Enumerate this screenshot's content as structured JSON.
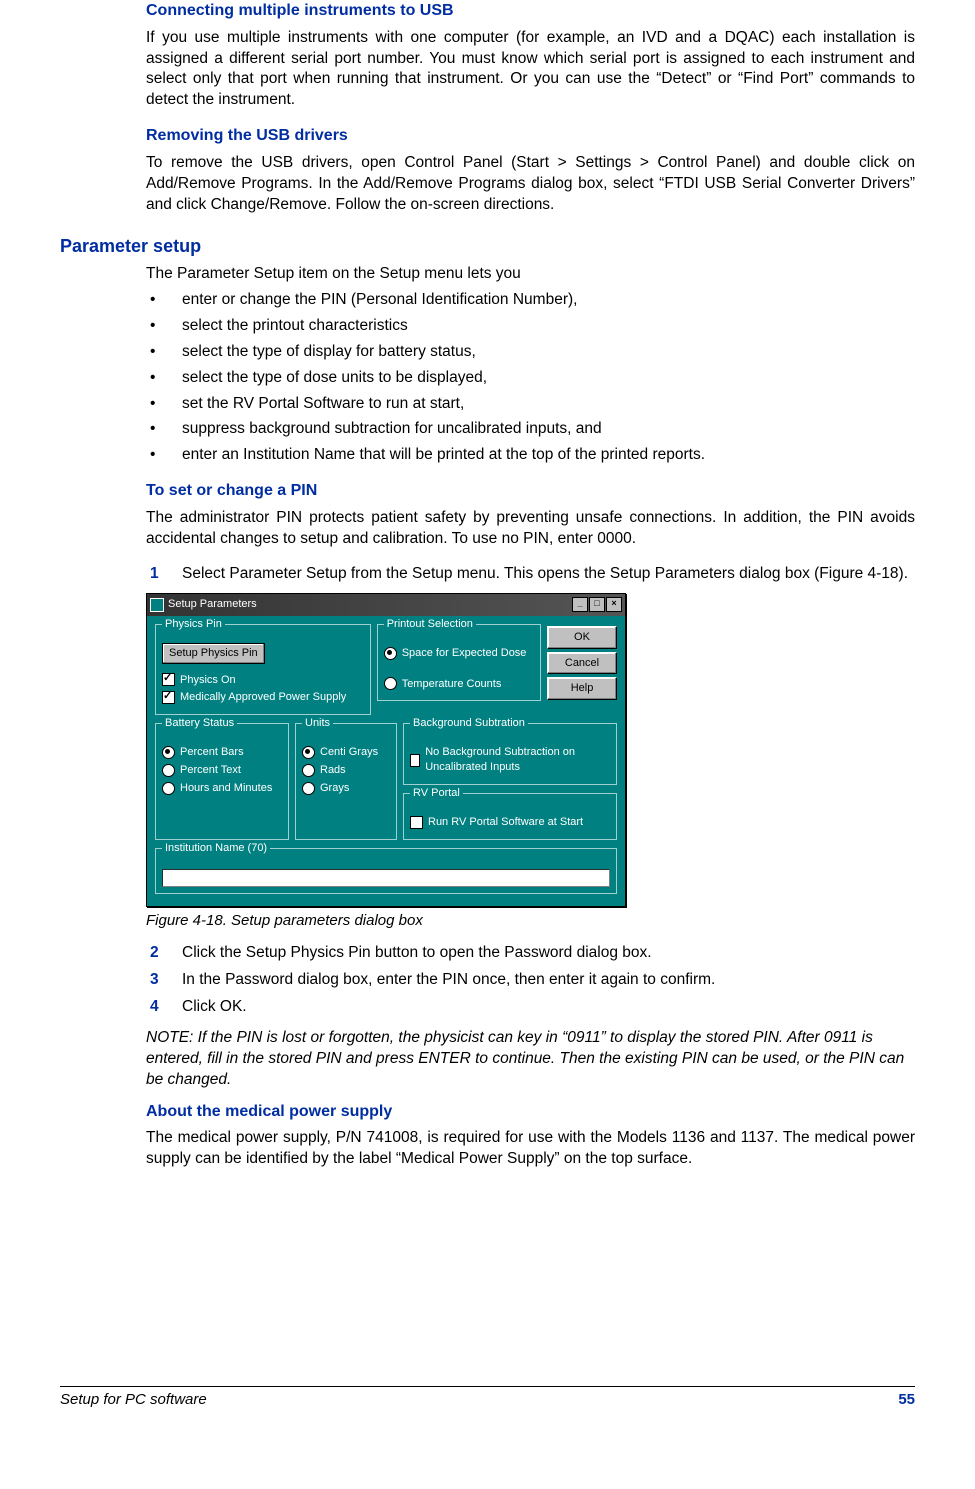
{
  "headings": {
    "h1": "Connecting multiple instruments to USB",
    "h2": "Removing the USB drivers",
    "h3_section": "Parameter setup",
    "h4": "To set or change a PIN",
    "h5": "About the medical power supply"
  },
  "paragraphs": {
    "p1": "If you use multiple instruments with one computer (for example, an IVD and a DQAC) each installation is assigned a different serial port number. You must know which serial port is assigned to each instrument and select only that port when running that instrument. Or you can use the “Detect” or “Find Port” commands to detect the instrument.",
    "p2": "To remove the USB drivers, open Control Panel (Start > Settings > Control Panel) and double click on Add/Remove Programs. In the Add/Remove Programs dialog box, select “FTDI USB Serial Converter Drivers” and click Change/Remove. Follow the on-screen directions.",
    "p3": "The Parameter Setup item on the Setup menu lets you",
    "p4": "The administrator PIN protects patient safety by preventing unsafe connections. In addition, the PIN avoids accidental changes to setup and calibration. To use no PIN, enter 0000.",
    "step1": "Select Parameter Setup from the Setup menu. This opens the Setup Parameters dialog box (Figure 4-18).",
    "caption": "Figure 4-18. Setup parameters dialog box",
    "step2": "Click the Setup Physics Pin button to open the Password dialog box.",
    "step3": "In the Password dialog box, enter the PIN once, then enter it again to confirm.",
    "step4": "Click OK.",
    "note": "NOTE: If the PIN is lost or forgotten, the physicist can key in “0911” to display the stored PIN. After 0911 is entered, fill in the stored PIN and press ENTER to continue. Then the existing PIN can be used, or the PIN can be changed.",
    "p5": "The medical power supply, P/N 741008, is required for use with the Models 1136 and 1137. The medical power supply can be identified by the label “Medical Power Supply” on the top surface."
  },
  "bullets": [
    "enter or change the PIN (Personal Identification Number),",
    "select the printout characteristics",
    "select the type of display for battery status,",
    "select the type of dose units to be displayed,",
    "set the RV Portal Software to run at start,",
    "suppress background subtraction for uncalibrated inputs, and",
    "enter an Institution Name that will be printed at the top of the printed reports."
  ],
  "step_numbers": {
    "n1": "1",
    "n2": "2",
    "n3": "3",
    "n4": "4"
  },
  "dialog": {
    "title": "Setup Parameters",
    "physics": {
      "legend": "Physics Pin",
      "button": "Setup Physics Pin",
      "chk1": "Physics On",
      "chk2": "Medically Approved Power Supply"
    },
    "printout": {
      "legend": "Printout Selection",
      "opt1": "Space for Expected Dose",
      "opt2": "Temperature Counts"
    },
    "buttons": {
      "ok": "OK",
      "cancel": "Cancel",
      "help": "Help"
    },
    "battery": {
      "legend": "Battery Status",
      "opt1": "Percent Bars",
      "opt2": "Percent Text",
      "opt3": "Hours and Minutes"
    },
    "units": {
      "legend": "Units",
      "opt1": "Centi Grays",
      "opt2": "Rads",
      "opt3": "Grays"
    },
    "bgsub": {
      "legend": "Background Subtration",
      "chk": "No Background Subtraction on Uncalibrated Inputs"
    },
    "rvportal": {
      "legend": "RV Portal",
      "chk": "Run RV Portal Software at Start"
    },
    "institution": {
      "legend": "Institution Name (70)"
    }
  },
  "footer": {
    "left": "Setup for PC software",
    "page": "55"
  }
}
